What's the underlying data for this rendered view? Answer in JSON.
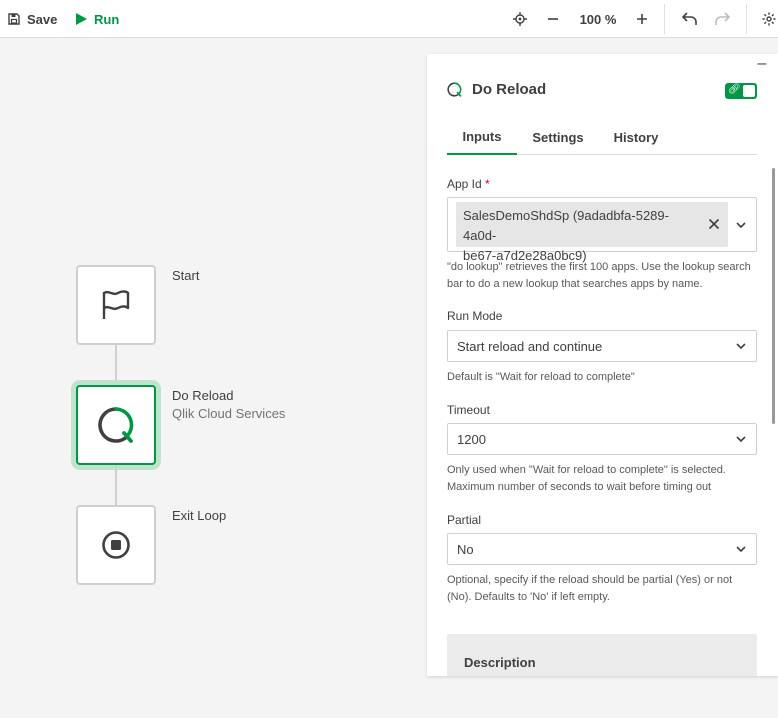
{
  "toolbar": {
    "save_label": "Save",
    "run_label": "Run",
    "zoom_level": "100 %"
  },
  "flow": {
    "nodes": [
      {
        "label": "Start",
        "sublabel": ""
      },
      {
        "label": "Do Reload",
        "sublabel": "Qlik Cloud Services"
      },
      {
        "label": "Exit Loop",
        "sublabel": ""
      }
    ]
  },
  "panel": {
    "title": "Do Reload",
    "tabs": [
      "Inputs",
      "Settings",
      "History"
    ],
    "active_tab": "Inputs",
    "fields": {
      "app_id": {
        "label": "App Id",
        "required_mark": "*",
        "value_line1": "SalesDemoShdSp (9adadbfa-5289-4a0d-",
        "value_line2": "be67-a7d2e28a0bc9)",
        "helper": "\"do lookup\" retrieves the first 100 apps. Use the lookup search bar to do a new lookup that searches apps by name."
      },
      "run_mode": {
        "label": "Run Mode",
        "value": "Start reload and continue",
        "helper": "Default is \"Wait for reload to complete\""
      },
      "timeout": {
        "label": "Timeout",
        "value": "1200",
        "helper": "Only used when \"Wait for reload to complete\" is selected. Maximum number of seconds to wait before timing out"
      },
      "partial": {
        "label": "Partial",
        "value": "No",
        "helper": "Optional, specify if the reload should be partial (Yes) or not (No). Defaults to 'No' if left empty."
      }
    },
    "description_title": "Description"
  },
  "colors": {
    "accent": "#009845",
    "accent_soft": "#bfe3cc",
    "required": "#d0021b",
    "canvas": "#f4f4f4"
  },
  "icons": {
    "save": "save-icon",
    "run": "play-icon",
    "target": "recenter-icon",
    "zoom_out": "minus-icon",
    "zoom_in": "plus-icon",
    "undo": "undo-icon",
    "redo": "redo-icon",
    "settings": "gear-icon",
    "start_node": "flag-icon",
    "reload_node": "qlik-icon",
    "exit_node": "stop-icon"
  }
}
